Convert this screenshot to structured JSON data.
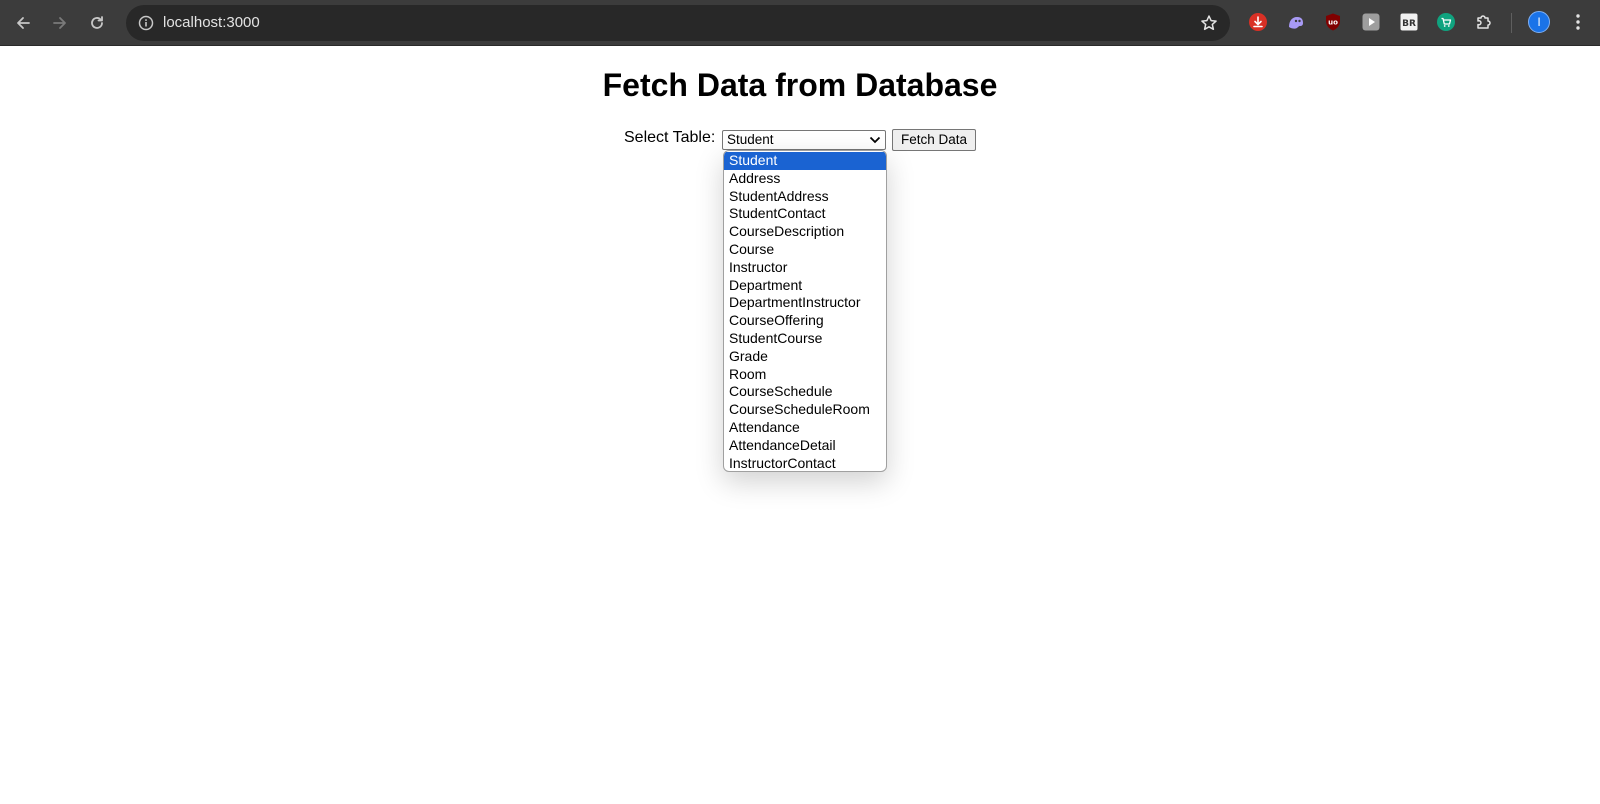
{
  "browser": {
    "url": "localhost:3000",
    "avatar_letter": "I"
  },
  "icons": {
    "back": "arrow-left-icon",
    "forward": "arrow-right-icon",
    "reload": "reload-icon",
    "site_info": "info-icon",
    "bookmark": "star-icon",
    "extensions": [
      "red-download-extension-icon",
      "purple-ghost-extension-icon",
      "ublock-extension-icon",
      "play-extension-icon",
      "br-extension-icon",
      "green-cart-extension-icon",
      "puzzle-extensions-icon"
    ],
    "menu": "kebab-menu-icon"
  },
  "page": {
    "title": "Fetch Data from Database",
    "select_label": "Select Table:",
    "selected_value": "Student",
    "fetch_button": "Fetch Data",
    "options": [
      "Student",
      "Address",
      "StudentAddress",
      "StudentContact",
      "CourseDescription",
      "Course",
      "Instructor",
      "Department",
      "DepartmentInstructor",
      "CourseOffering",
      "StudentCourse",
      "Grade",
      "Room",
      "CourseSchedule",
      "CourseScheduleRoom",
      "Attendance",
      "AttendanceDetail",
      "InstructorContact"
    ],
    "highlighted_index": 0
  },
  "colors": {
    "toolbar": "#3c3c3c",
    "omnibox": "#282828",
    "highlight": "#1a63d2"
  }
}
